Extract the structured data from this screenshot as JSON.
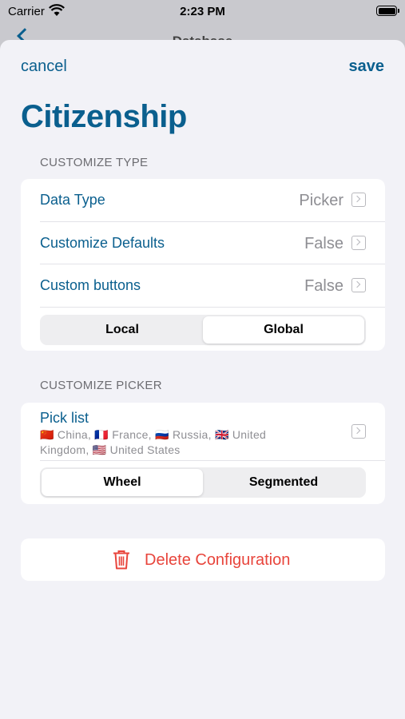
{
  "status_bar": {
    "carrier": "Carrier",
    "time": "2:23 PM"
  },
  "behind_nav": {
    "title": "Database"
  },
  "nav": {
    "cancel_label": "cancel",
    "save_label": "save"
  },
  "title": "Citizenship",
  "customize_type": {
    "header": "CUSTOMIZE TYPE",
    "rows": [
      {
        "label": "Data Type",
        "value": "Picker"
      },
      {
        "label": "Customize Defaults",
        "value": "False"
      },
      {
        "label": "Custom buttons",
        "value": "False"
      }
    ],
    "segmented": {
      "options": [
        "Local",
        "Global"
      ],
      "selected": "Global"
    }
  },
  "customize_picker": {
    "header": "CUSTOMIZE PICKER",
    "pick_list": {
      "label": "Pick list",
      "detail": "🇨🇳 China, 🇫🇷 France, 🇷🇺 Russia, 🇬🇧 United Kingdom, 🇺🇸 United States"
    },
    "segmented": {
      "options": [
        "Wheel",
        "Segmented"
      ],
      "selected": "Wheel"
    }
  },
  "delete": {
    "label": "Delete Configuration"
  },
  "colors": {
    "accent": "#0a5f8e",
    "destructive": "#e8453c",
    "background": "#f2f2f7"
  }
}
